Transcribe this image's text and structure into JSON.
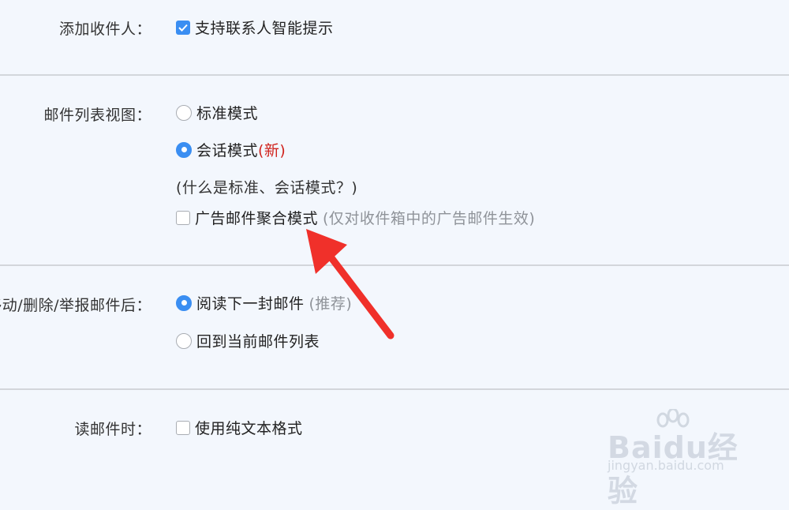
{
  "add_recipient": {
    "label": "添加收件人：",
    "smart_hint": {
      "label": "支持联系人智能提示",
      "checked": true
    }
  },
  "list_view": {
    "label": "邮件列表视图：",
    "standard": {
      "label": "标准模式",
      "selected": false
    },
    "conversation": {
      "label": "会话模式",
      "badge": "(新)",
      "selected": true
    },
    "help_link": "(什么是标准、会话模式？)",
    "ad_aggregate": {
      "label": "广告邮件聚合模式",
      "note": "(仅对收件箱中的广告邮件生效)",
      "checked": false
    }
  },
  "after_action": {
    "label": "移动/删除/举报邮件后：",
    "read_next": {
      "label": "阅读下一封邮件",
      "note": "(推荐)",
      "selected": true
    },
    "back_to_list": {
      "label": "回到当前邮件列表",
      "selected": false
    }
  },
  "reading": {
    "label": "读邮件时：",
    "plain_text": {
      "label": "使用纯文本格式",
      "checked": false
    }
  },
  "watermark": {
    "text": "Baidu经验",
    "url": "jingyan.baidu.com"
  },
  "colors": {
    "accent": "#3a8ef2",
    "arrow": "#f0302a",
    "badge": "#d0231d",
    "background": "#f3f7fd"
  }
}
